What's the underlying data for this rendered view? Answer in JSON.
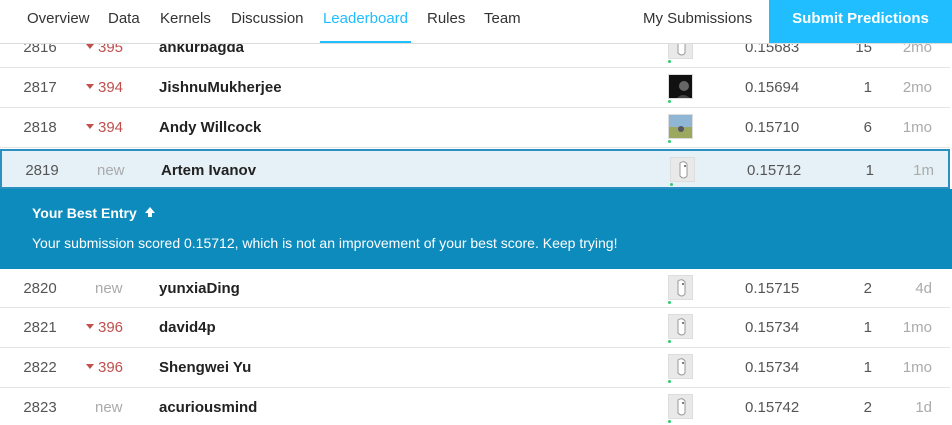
{
  "nav": {
    "tabs": [
      {
        "label": "Overview"
      },
      {
        "label": "Data"
      },
      {
        "label": "Kernels"
      },
      {
        "label": "Discussion"
      },
      {
        "label": "Leaderboard"
      },
      {
        "label": "Rules"
      },
      {
        "label": "Team"
      }
    ],
    "active_tab": "Leaderboard",
    "my_submissions": "My Submissions",
    "submit_label": "Submit Predictions"
  },
  "rows": [
    {
      "rank": "2816",
      "change": "395",
      "change_type": "down",
      "name": "ankurbagda",
      "score": "0.15683",
      "entries": "15",
      "last": "2mo",
      "avatar": "default"
    },
    {
      "rank": "2817",
      "change": "394",
      "change_type": "down",
      "name": "JishnuMukherjee",
      "score": "0.15694",
      "entries": "1",
      "last": "2mo",
      "avatar": "dark"
    },
    {
      "rank": "2818",
      "change": "394",
      "change_type": "down",
      "name": "Andy Willcock",
      "score": "0.15710",
      "entries": "6",
      "last": "1mo",
      "avatar": "landscape"
    },
    {
      "rank": "2819",
      "change": "new",
      "change_type": "new",
      "name": "Artem Ivanov",
      "score": "0.15712",
      "entries": "1",
      "last": "1m",
      "avatar": "default"
    },
    {
      "rank": "2820",
      "change": "new",
      "change_type": "new",
      "name": "yunxiaDing",
      "score": "0.15715",
      "entries": "2",
      "last": "4d",
      "avatar": "default"
    },
    {
      "rank": "2821",
      "change": "396",
      "change_type": "down",
      "name": "david4p",
      "score": "0.15734",
      "entries": "1",
      "last": "1mo",
      "avatar": "default"
    },
    {
      "rank": "2822",
      "change": "396",
      "change_type": "down",
      "name": "Shengwei Yu",
      "score": "0.15734",
      "entries": "1",
      "last": "1mo",
      "avatar": "default"
    },
    {
      "rank": "2823",
      "change": "new",
      "change_type": "new",
      "name": "acuriousmind",
      "score": "0.15742",
      "entries": "2",
      "last": "1d",
      "avatar": "default"
    }
  ],
  "banner": {
    "title": "Your Best Entry",
    "arrow": "🡅",
    "message": "Your submission scored 0.15712, which is not an improvement of your best score. Keep trying!"
  },
  "colors": {
    "accent": "#20beff",
    "banner": "#0d8bbd",
    "down": "#c0504d",
    "highlight_border": "#2b8fc0",
    "highlight_bg": "#e6f1f7"
  }
}
